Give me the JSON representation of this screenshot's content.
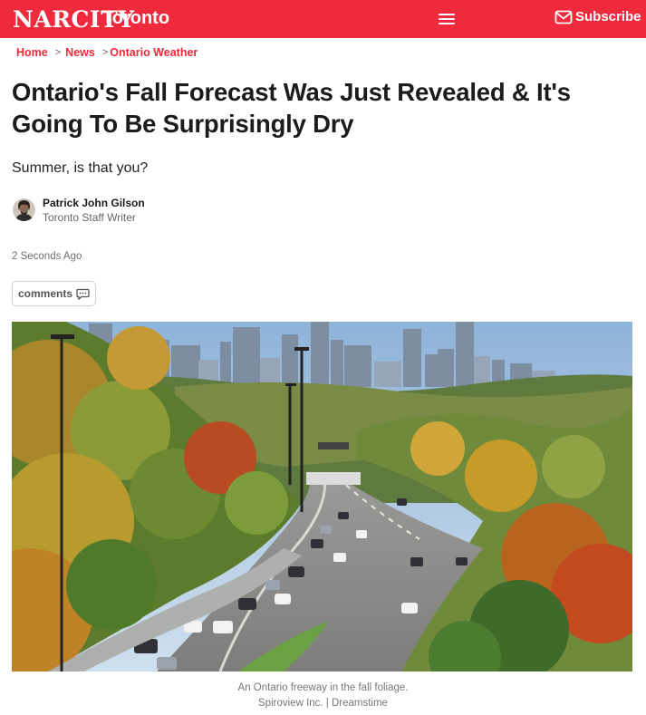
{
  "header": {
    "logo": "NARCITY",
    "city": "Toronto",
    "menu_icon": "hamburger-menu-icon",
    "subscribe_label": "Subscribe",
    "subscribe_icon": "envelope-icon",
    "brand_color": "#ee2a3c"
  },
  "breadcrumb": {
    "items": [
      {
        "label": "Home"
      },
      {
        "label": "News"
      },
      {
        "label": "Ontario Weather"
      }
    ],
    "separator": ">"
  },
  "article": {
    "headline": "Ontario's Fall Forecast Was Just Revealed & It's Going To Be Surprisingly Dry",
    "dek": "Summer, is that you?",
    "author": {
      "name": "Patrick John Gilson",
      "role": "Toronto Staff Writer"
    },
    "timestamp": "2 Seconds Ago",
    "comments_label": "comments",
    "comments_icon": "chat-bubble-icon",
    "image": {
      "caption": "An Ontario freeway in the fall foliage.",
      "credit": "Spiroview Inc. | Dreamstime"
    }
  }
}
